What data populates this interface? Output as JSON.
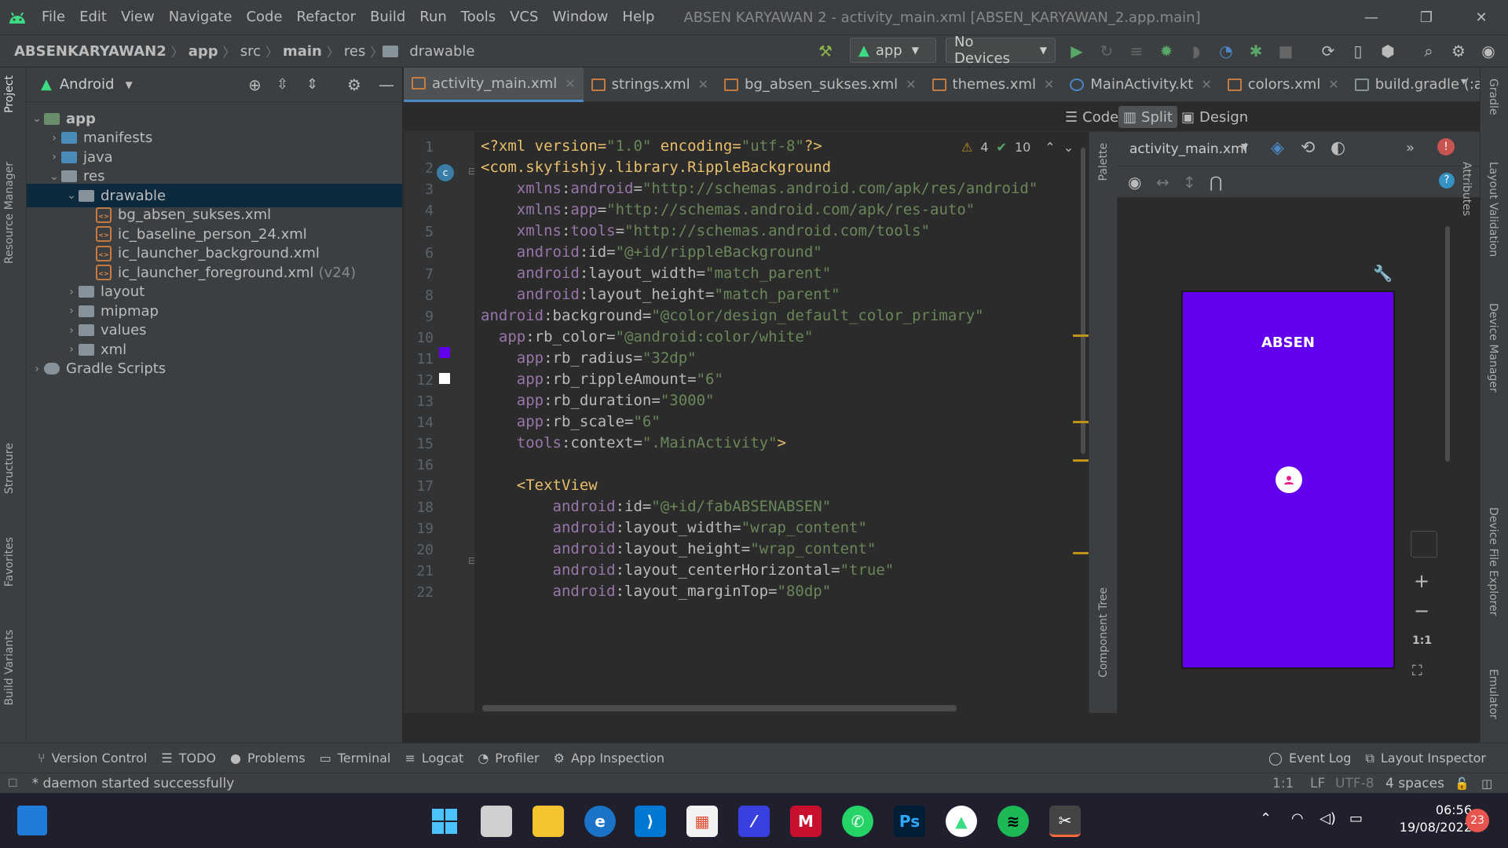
{
  "menu": {
    "items": [
      "File",
      "Edit",
      "View",
      "Navigate",
      "Code",
      "Refactor",
      "Build",
      "Run",
      "Tools",
      "VCS",
      "Window",
      "Help"
    ],
    "window_title": "ABSEN KARYAWAN 2 - activity_main.xml [ABSEN_KARYAWAN_2.app.main]"
  },
  "breadcrumb": [
    "ABSENKARYAWAN2",
    "app",
    "src",
    "main",
    "res",
    "drawable"
  ],
  "toolbar": {
    "run_config": "app",
    "devices": "No Devices"
  },
  "project": {
    "view_label": "Android",
    "tree": [
      {
        "label": "app",
        "depth": 0,
        "kind": "module",
        "open": true
      },
      {
        "label": "manifests",
        "depth": 1,
        "kind": "folder-blue",
        "open": false
      },
      {
        "label": "java",
        "depth": 1,
        "kind": "folder-blue",
        "open": false
      },
      {
        "label": "res",
        "depth": 1,
        "kind": "folder",
        "open": true
      },
      {
        "label": "drawable",
        "depth": 2,
        "kind": "folder",
        "open": true,
        "selected": true
      },
      {
        "label": "bg_absen_sukses.xml",
        "depth": 3,
        "kind": "xml"
      },
      {
        "label": "ic_baseline_person_24.xml",
        "depth": 3,
        "kind": "xml"
      },
      {
        "label": "ic_launcher_background.xml",
        "depth": 3,
        "kind": "xml"
      },
      {
        "label": "ic_launcher_foreground.xml",
        "depth": 3,
        "kind": "xml",
        "suffix": "(v24)"
      },
      {
        "label": "layout",
        "depth": 2,
        "kind": "folder",
        "open": false
      },
      {
        "label": "mipmap",
        "depth": 2,
        "kind": "folder",
        "open": false
      },
      {
        "label": "values",
        "depth": 2,
        "kind": "folder",
        "open": false
      },
      {
        "label": "xml",
        "depth": 2,
        "kind": "folder",
        "open": false
      },
      {
        "label": "Gradle Scripts",
        "depth": 0,
        "kind": "gradle",
        "open": false
      }
    ]
  },
  "tabs": [
    {
      "label": "activity_main.xml",
      "icon": "xml",
      "active": true
    },
    {
      "label": "strings.xml",
      "icon": "xml"
    },
    {
      "label": "bg_absen_sukses.xml",
      "icon": "xml"
    },
    {
      "label": "themes.xml",
      "icon": "xml"
    },
    {
      "label": "MainActivity.kt",
      "icon": "kt"
    },
    {
      "label": "colors.xml",
      "icon": "xml"
    },
    {
      "label": "build.gradle (:app)",
      "icon": "gradle"
    }
  ],
  "view_modes": {
    "code": "Code",
    "split": "Split",
    "design": "Design"
  },
  "inspections": {
    "warnings": "4",
    "ok": "10"
  },
  "code_lines": [
    [
      [
        "pi",
        "<?xml version="
      ],
      [
        "val",
        "\"1.0\""
      ],
      [
        "pi",
        " encoding="
      ],
      [
        "val",
        "\"utf-8\""
      ],
      [
        "pi",
        "?>"
      ]
    ],
    [
      [
        "tag",
        "<com.skyfishjy.library.RippleBackground"
      ]
    ],
    [
      [
        "sp",
        "    "
      ],
      [
        "ns",
        "xmlns"
      ],
      [
        "at",
        ":"
      ],
      [
        "ns",
        "android"
      ],
      [
        "at",
        "="
      ],
      [
        "val",
        "\"http://schemas.android.com/apk/res/android\""
      ]
    ],
    [
      [
        "sp",
        "    "
      ],
      [
        "ns",
        "xmlns"
      ],
      [
        "at",
        ":"
      ],
      [
        "ns",
        "app"
      ],
      [
        "at",
        "="
      ],
      [
        "val",
        "\"http://schemas.android.com/apk/res-auto\""
      ]
    ],
    [
      [
        "sp",
        "    "
      ],
      [
        "ns",
        "xmlns"
      ],
      [
        "at",
        ":"
      ],
      [
        "ns",
        "tools"
      ],
      [
        "at",
        "="
      ],
      [
        "val",
        "\"http://schemas.android.com/tools\""
      ]
    ],
    [
      [
        "sp",
        "    "
      ],
      [
        "ns",
        "android"
      ],
      [
        "at",
        ":id="
      ],
      [
        "val",
        "\"@+id/rippleBackground\""
      ]
    ],
    [
      [
        "sp",
        "    "
      ],
      [
        "ns",
        "android"
      ],
      [
        "at",
        ":layout_width="
      ],
      [
        "val",
        "\"match_parent\""
      ]
    ],
    [
      [
        "sp",
        "    "
      ],
      [
        "ns",
        "android"
      ],
      [
        "at",
        ":layout_height="
      ],
      [
        "val",
        "\"match_parent\""
      ]
    ],
    [
      [
        "ns",
        "android"
      ],
      [
        "at",
        ":background="
      ],
      [
        "val",
        "\"@color/design_default_color_primary\""
      ]
    ],
    [
      [
        "sp",
        "  "
      ],
      [
        "ns",
        "app"
      ],
      [
        "at",
        ":rb_color="
      ],
      [
        "val",
        "\"@android:color/white\""
      ]
    ],
    [
      [
        "sp",
        "    "
      ],
      [
        "ns",
        "app"
      ],
      [
        "at",
        ":rb_radius="
      ],
      [
        "val",
        "\"32dp\""
      ]
    ],
    [
      [
        "sp",
        "    "
      ],
      [
        "ns",
        "app"
      ],
      [
        "at",
        ":rb_rippleAmount="
      ],
      [
        "val",
        "\"6\""
      ]
    ],
    [
      [
        "sp",
        "    "
      ],
      [
        "ns",
        "app"
      ],
      [
        "at",
        ":rb_duration="
      ],
      [
        "val",
        "\"3000\""
      ]
    ],
    [
      [
        "sp",
        "    "
      ],
      [
        "ns",
        "app"
      ],
      [
        "at",
        ":rb_scale="
      ],
      [
        "val",
        "\"6\""
      ]
    ],
    [
      [
        "sp",
        "    "
      ],
      [
        "ns",
        "tools"
      ],
      [
        "at",
        ":context="
      ],
      [
        "val",
        "\".MainActivity\""
      ],
      [
        "tag",
        ">"
      ]
    ],
    [],
    [
      [
        "sp",
        "    "
      ],
      [
        "tag",
        "<TextView"
      ]
    ],
    [
      [
        "sp",
        "        "
      ],
      [
        "ns",
        "android"
      ],
      [
        "at",
        ":id="
      ],
      [
        "val",
        "\"@+id/fabABSENABSEN\""
      ]
    ],
    [
      [
        "sp",
        "        "
      ],
      [
        "ns",
        "android"
      ],
      [
        "at",
        ":layout_width="
      ],
      [
        "val",
        "\"wrap_content\""
      ]
    ],
    [
      [
        "sp",
        "        "
      ],
      [
        "ns",
        "android"
      ],
      [
        "at",
        ":layout_height="
      ],
      [
        "val",
        "\"wrap_content\""
      ]
    ],
    [
      [
        "sp",
        "        "
      ],
      [
        "ns",
        "android"
      ],
      [
        "at",
        ":layout_centerHorizontal="
      ],
      [
        "val",
        "\"true\""
      ]
    ],
    [
      [
        "sp",
        "        "
      ],
      [
        "ns",
        "android"
      ],
      [
        "at",
        ":layout_marginTop="
      ],
      [
        "val",
        "\"80dp\""
      ]
    ]
  ],
  "line_numbers": [
    "1",
    "2",
    "3",
    "4",
    "5",
    "6",
    "7",
    "8",
    "9",
    "10",
    "11",
    "12",
    "13",
    "14",
    "15",
    "16",
    "17",
    "18",
    "19",
    "20",
    "21",
    "22"
  ],
  "preview": {
    "file": "activity_main.xml",
    "device_text": "ABSEN",
    "device_color": "#6200ee",
    "zoom_fit": "1:1"
  },
  "side_tabs_left": [
    "Project",
    "Resource Manager",
    "Structure",
    "Favorites",
    "Build Variants"
  ],
  "side_tabs_right": [
    "Gradle",
    "Layout Validation",
    "Device Manager",
    "Device File Explorer",
    "Emulator"
  ],
  "palette_tabs": [
    "Palette",
    "Component Tree"
  ],
  "attributes_tab": "Attributes",
  "bottom_tools": [
    "Version Control",
    "TODO",
    "Problems",
    "Terminal",
    "Logcat",
    "Profiler",
    "App Inspection"
  ],
  "bottom_right_tools": [
    "Event Log",
    "Layout Inspector"
  ],
  "status": {
    "message": "* daemon started successfully",
    "position": "1:1",
    "line_sep": "LF",
    "encoding": "UTF-8",
    "indent": "4 spaces"
  },
  "taskbar": {
    "time": "06:56",
    "date": "19/08/2022",
    "notifications": "23"
  }
}
